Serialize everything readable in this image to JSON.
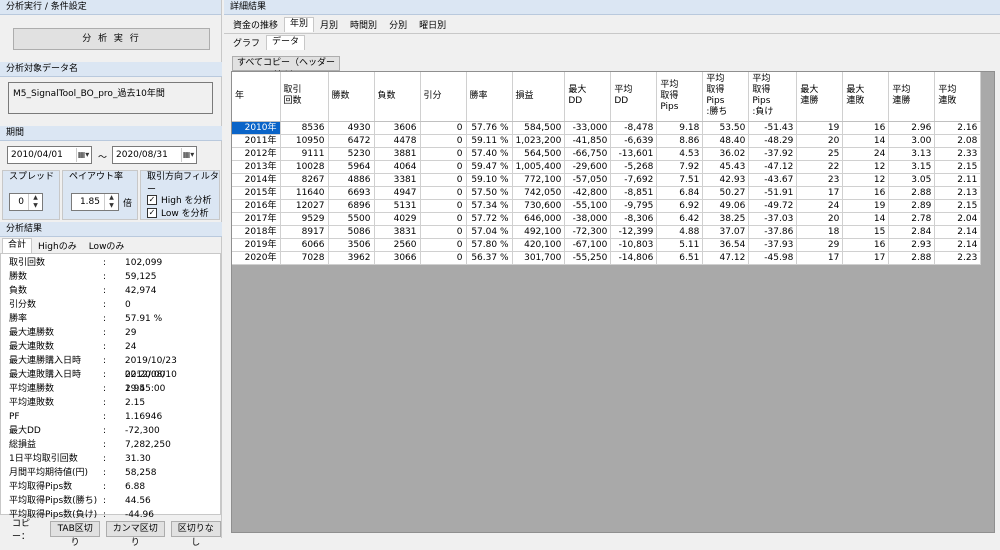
{
  "left": {
    "section_run": "分析実行 / 条件設定",
    "run_button": "分 析 実 行",
    "section_data": "分析対象データ名",
    "data_name": "M5_SignalTool_BO_pro_過去10年間",
    "section_period": "期間",
    "date_from": "2010/04/01",
    "date_tilde": "～",
    "date_to": "2020/08/31",
    "spread_label": "スプレッド",
    "spread_value": "0",
    "payout_label": "ペイアウト率",
    "payout_value": "1.85",
    "payout_unit": "倍",
    "direction_label": "取引方向フィルター",
    "high_label": "High を分析",
    "low_label": "Low を分析",
    "section_results": "分析結果",
    "result_tabs": [
      "合計",
      "Highのみ",
      "Lowのみ"
    ],
    "stats": [
      {
        "k": "取引回数",
        "v": "102,099"
      },
      {
        "k": "勝数",
        "v": "59,125"
      },
      {
        "k": "負数",
        "v": "42,974"
      },
      {
        "k": "引分数",
        "v": "0"
      },
      {
        "k": "勝率",
        "v": "57.91 %"
      },
      {
        "k": "最大連勝数",
        "v": "29"
      },
      {
        "k": "最大連敗数",
        "v": "24"
      },
      {
        "k": "最大連勝購入日時",
        "v": "2019/10/23 02:20:00"
      },
      {
        "k": "最大連敗購入日時",
        "v": "2012/08/10 19:45:00"
      },
      {
        "k": "平均連勝数",
        "v": "2.95"
      },
      {
        "k": "平均連敗数",
        "v": "2.15"
      },
      {
        "k": "PF",
        "v": "1.16946"
      },
      {
        "k": "最大DD",
        "v": "-72,300"
      },
      {
        "k": "総損益",
        "v": "7,282,250"
      },
      {
        "k": "1日平均取引回数",
        "v": "31.30"
      },
      {
        "k": "月間平均期待値(円)",
        "v": "58,258"
      },
      {
        "k": "平均取得Pips数",
        "v": "6.88"
      },
      {
        "k": "平均取得Pips数(勝ち)",
        "v": "44.56"
      },
      {
        "k": "平均取得Pips数(負け)",
        "v": "-44.96"
      }
    ],
    "stat_colon": ":",
    "copy_label": "コピー：",
    "copy_buttons": [
      "TAB区切り",
      "カンマ区切り",
      "区切りなし"
    ]
  },
  "right": {
    "title": "詳細結果",
    "tabs": [
      "資金の推移",
      "年別",
      "月別",
      "時間別",
      "分別",
      "曜日別"
    ],
    "subtabs": [
      "グラフ",
      "データ"
    ],
    "copy_all": "すべてコピー（ヘッダー付き）",
    "headers": [
      "年",
      "取引\n回数",
      "勝数",
      "負数",
      "引分",
      "勝率",
      "損益",
      "最大\nDD",
      "平均\nDD",
      "平均\n取得\nPips",
      "平均\n取得\nPips\n:勝ち",
      "平均\n取得\nPips\n:負け",
      "最大\n連勝",
      "最大\n連敗",
      "平均\n連勝",
      "平均\n連敗"
    ],
    "rows": [
      [
        "2010年",
        "8536",
        "4930",
        "3606",
        "0",
        "57.76 %",
        "584,500",
        "-33,000",
        "-8,478",
        "9.18",
        "53.50",
        "-51.43",
        "19",
        "16",
        "2.96",
        "2.16"
      ],
      [
        "2011年",
        "10950",
        "6472",
        "4478",
        "0",
        "59.11 %",
        "1,023,200",
        "-41,850",
        "-6,639",
        "8.86",
        "48.40",
        "-48.29",
        "20",
        "14",
        "3.00",
        "2.08"
      ],
      [
        "2012年",
        "9111",
        "5230",
        "3881",
        "0",
        "57.40 %",
        "564,500",
        "-66,750",
        "-13,601",
        "4.53",
        "36.02",
        "-37.92",
        "25",
        "24",
        "3.13",
        "2.33"
      ],
      [
        "2013年",
        "10028",
        "5964",
        "4064",
        "0",
        "59.47 %",
        "1,005,400",
        "-29,600",
        "-5,268",
        "7.92",
        "45.43",
        "-47.12",
        "22",
        "12",
        "3.15",
        "2.15"
      ],
      [
        "2014年",
        "8267",
        "4886",
        "3381",
        "0",
        "59.10 %",
        "772,100",
        "-57,050",
        "-7,692",
        "7.51",
        "42.93",
        "-43.67",
        "23",
        "12",
        "3.05",
        "2.11"
      ],
      [
        "2015年",
        "11640",
        "6693",
        "4947",
        "0",
        "57.50 %",
        "742,050",
        "-42,800",
        "-8,851",
        "6.84",
        "50.27",
        "-51.91",
        "17",
        "16",
        "2.88",
        "2.13"
      ],
      [
        "2016年",
        "12027",
        "6896",
        "5131",
        "0",
        "57.34 %",
        "730,600",
        "-55,100",
        "-9,795",
        "6.92",
        "49.06",
        "-49.72",
        "24",
        "19",
        "2.89",
        "2.15"
      ],
      [
        "2017年",
        "9529",
        "5500",
        "4029",
        "0",
        "57.72 %",
        "646,000",
        "-38,000",
        "-8,306",
        "6.42",
        "38.25",
        "-37.03",
        "20",
        "14",
        "2.78",
        "2.04"
      ],
      [
        "2018年",
        "8917",
        "5086",
        "3831",
        "0",
        "57.04 %",
        "492,100",
        "-72,300",
        "-12,399",
        "4.88",
        "37.07",
        "-37.86",
        "18",
        "15",
        "2.84",
        "2.14"
      ],
      [
        "2019年",
        "6066",
        "3506",
        "2560",
        "0",
        "57.80 %",
        "420,100",
        "-67,100",
        "-10,803",
        "5.11",
        "36.54",
        "-37.93",
        "29",
        "16",
        "2.93",
        "2.14"
      ],
      [
        "2020年",
        "7028",
        "3962",
        "3066",
        "0",
        "56.37 %",
        "301,700",
        "-55,250",
        "-14,806",
        "6.51",
        "47.12",
        "-45.98",
        "17",
        "17",
        "2.88",
        "2.23"
      ]
    ]
  },
  "colors": {
    "section_bg": "#dbe6f3",
    "selected": "#0a64c8",
    "grid_bg": "#a9a9a9"
  }
}
